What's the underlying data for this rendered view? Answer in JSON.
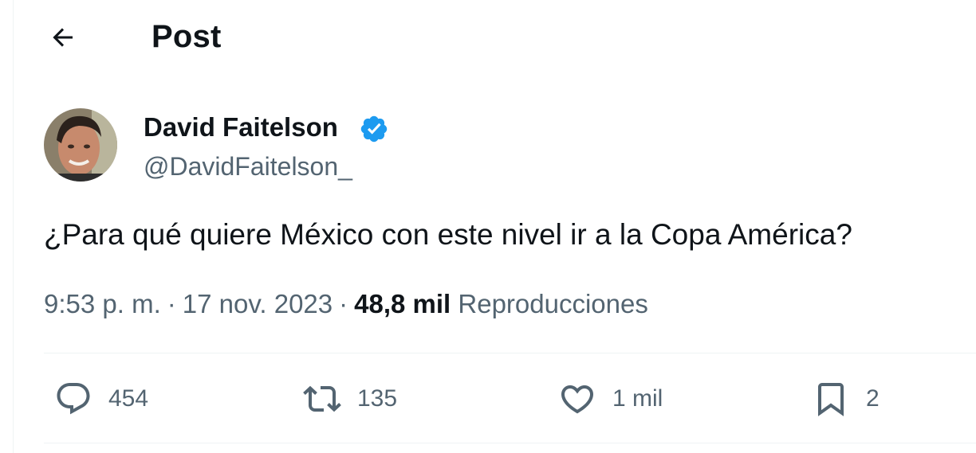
{
  "header": {
    "title": "Post"
  },
  "author": {
    "name": "David Faitelson",
    "handle": "@DavidFaitelson_",
    "verified": true
  },
  "post": {
    "text": "¿Para qué quiere México con este nivel ir a la Copa América?",
    "time": "9:53 p. m.",
    "date": "17 nov. 2023",
    "separator": "·",
    "views_count": "48,8 mil",
    "views_label": "Reproducciones"
  },
  "actions": {
    "replies": "454",
    "reposts": "135",
    "likes": "1 mil",
    "bookmarks": "2"
  },
  "icons": {
    "back": "arrow-left-icon",
    "verified": "verified-badge-icon",
    "reply": "reply-icon",
    "repost": "repost-icon",
    "like": "heart-icon",
    "bookmark": "bookmark-icon"
  },
  "colors": {
    "text_primary": "#0f1419",
    "text_secondary": "#536471",
    "verified_blue": "#1d9bf0",
    "divider": "#eff3f4"
  }
}
